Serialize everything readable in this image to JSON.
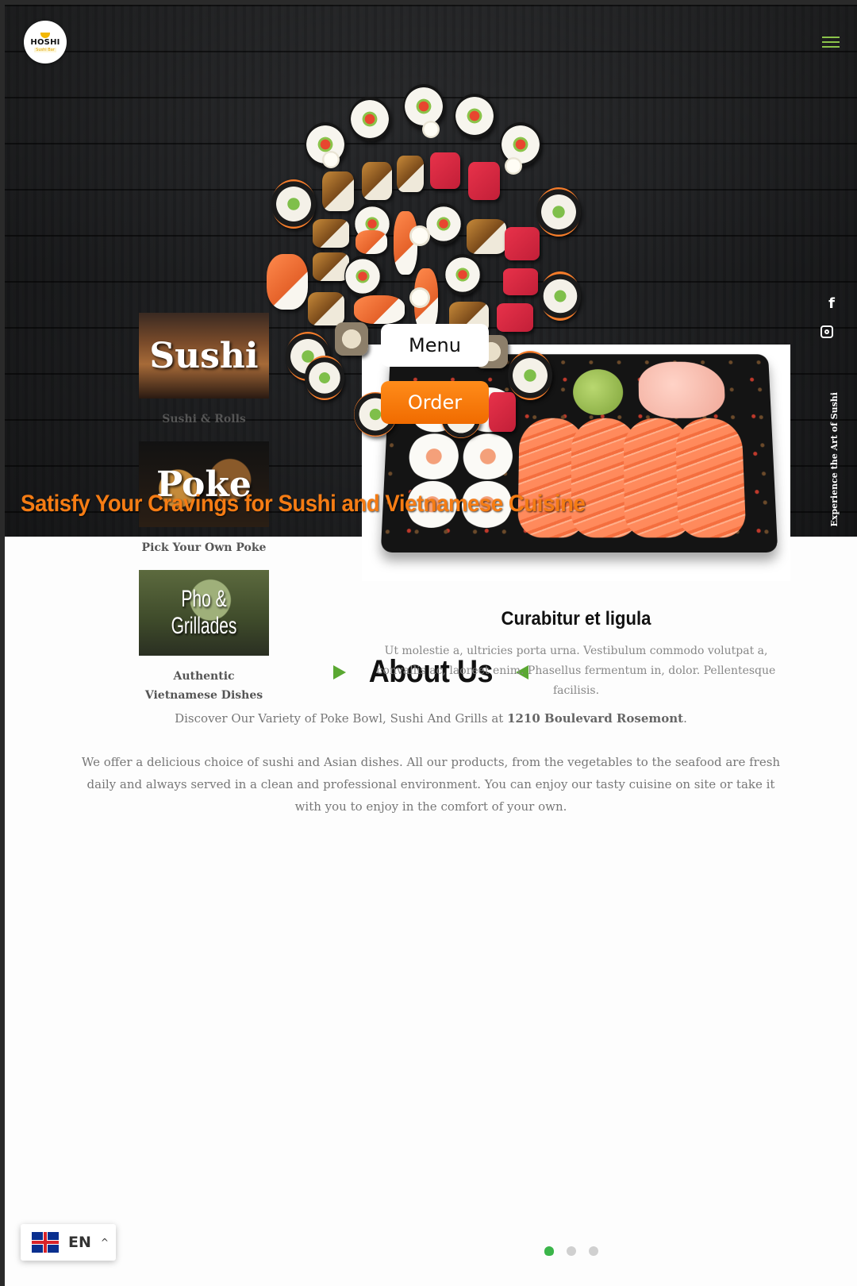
{
  "header": {
    "logo_name": "HOSHI",
    "logo_sub": "Sushi Bar",
    "menu_icon": "hamburger-icon"
  },
  "hero": {
    "menu_button": "Menu",
    "order_button": "Order",
    "social": {
      "facebook_label": "f",
      "facebook_icon": "facebook-icon",
      "instagram_icon": "instagram-icon"
    },
    "vertical_tagline": "Experience the Art of Sushi",
    "title": "Satisfy Your Cravings for Sushi and Vietnamese Cuisine",
    "title_color": "#f57c14"
  },
  "about": {
    "title": "About Us",
    "discover_prefix": "Discover Our Variety of Poke Bowl, Sushi And Grills at ",
    "discover_address": "1210 Boulevard Rosemont",
    "discover_suffix": ".",
    "paragraph": "We offer a delicious choice of sushi and Asian dishes. All our products, from the vegetables to the seafood are fresh daily and always served in a clean and professional environment. You can enjoy our tasty cuisine on site or take it with you to enjoy in the comfort of your own.",
    "accent_color": "#5aa832"
  },
  "categories": [
    {
      "image_text": "Sushi",
      "label": "Sushi & Rolls"
    },
    {
      "image_text": "Poke",
      "label": "Pick Your Own Poke"
    },
    {
      "image_text": "Pho & Grillades",
      "label": "Authentic Vietnamese Dishes"
    }
  ],
  "slider": {
    "title": "Curabitur et ligula",
    "text": "Ut molestie a, ultricies porta urna. Vestibulum commodo volutpat a, convallis ac, laoreet enim. Phasellus fermentum in, dolor. Pellentesque facilisis.",
    "slide_count": 3,
    "active_slide": 1
  },
  "language": {
    "code": "EN",
    "flag_icon": "uk-flag-icon",
    "caret_icon": "chevron-up-icon"
  }
}
